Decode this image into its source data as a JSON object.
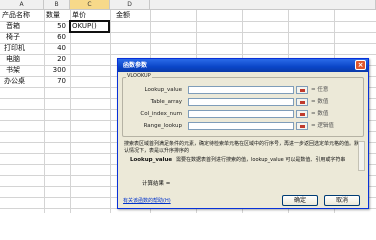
{
  "sheet": {
    "columns": [
      {
        "letter": "A"
      },
      {
        "letter": "B"
      },
      {
        "letter": "C"
      },
      {
        "letter": "D"
      }
    ],
    "header_row": {
      "a": "产品名称",
      "b": "数量",
      "c": "单价",
      "d": "金额"
    },
    "active_cell_text": "OKUP()",
    "rows": [
      {
        "name": "音箱",
        "qty": "50"
      },
      {
        "name": "椅子",
        "qty": "60"
      },
      {
        "name": "打印机",
        "qty": "40"
      },
      {
        "name": "电脑",
        "qty": "20"
      },
      {
        "name": "书架",
        "qty": "300"
      },
      {
        "name": "办公桌",
        "qty": "70"
      }
    ]
  },
  "dialog": {
    "title": "函数参数",
    "function_name": "VLOOKUP",
    "args": [
      {
        "label": "Lookup_value",
        "eq": "= 任意"
      },
      {
        "label": "Table_array",
        "eq": "= 数值"
      },
      {
        "label": "Col_index_num",
        "eq": "= 数值"
      },
      {
        "label": "Range_lookup",
        "eq": "= 逻辑值"
      }
    ],
    "description": "搜索表区域首列满足条件的元素，确定待检索单元格在区域中的行序号，再进一步返回选定单元格的值。默认情况下，表是以升序排序的",
    "arg_desc_name": "Lookup_value",
    "arg_desc_text": "需要在数据表首列进行搜索的值，lookup_value 可以是数值、引用或字符串",
    "calc_result_label": "计算结果 =",
    "help_link": "有关该函数的帮助(H)",
    "ok_label": "确定",
    "cancel_label": "取消"
  }
}
